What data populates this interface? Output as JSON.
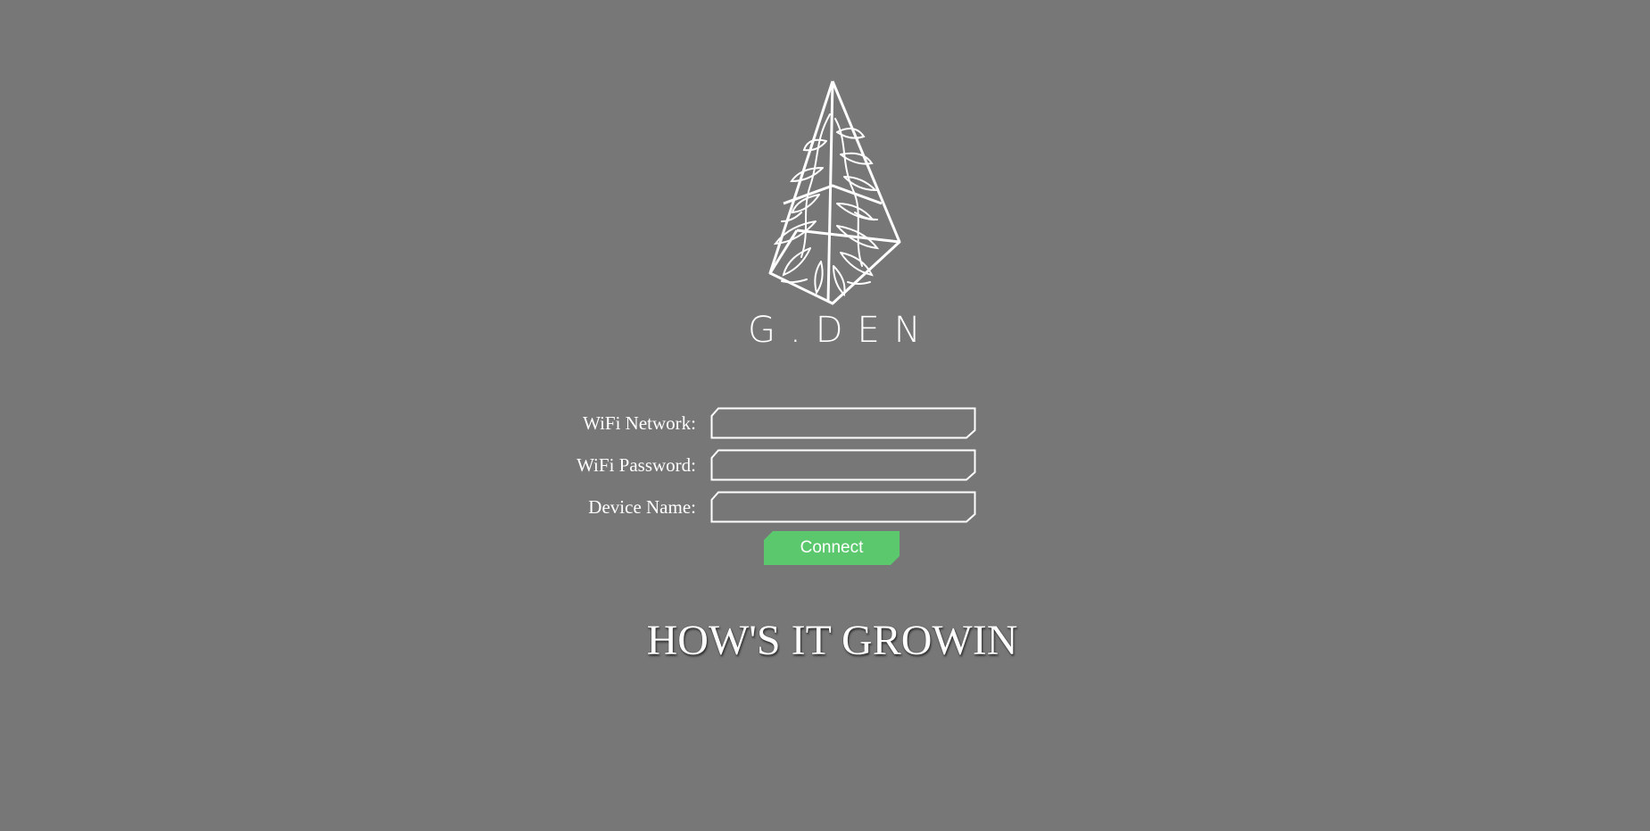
{
  "brand": {
    "name": "G.DEN",
    "logo_icon": "crystal-plant-logo-icon"
  },
  "form": {
    "fields": [
      {
        "label": "WiFi Network:",
        "value": "",
        "name": "wifi-network"
      },
      {
        "label": "WiFi Password:",
        "value": "",
        "name": "wifi-password"
      },
      {
        "label": "Device Name:",
        "value": "",
        "name": "device-name"
      }
    ],
    "connect_label": "Connect"
  },
  "tagline": "HOW'S IT GROWIN",
  "colors": {
    "background": "#777777",
    "accent": "#5bc86e",
    "text": "#ffffff"
  }
}
